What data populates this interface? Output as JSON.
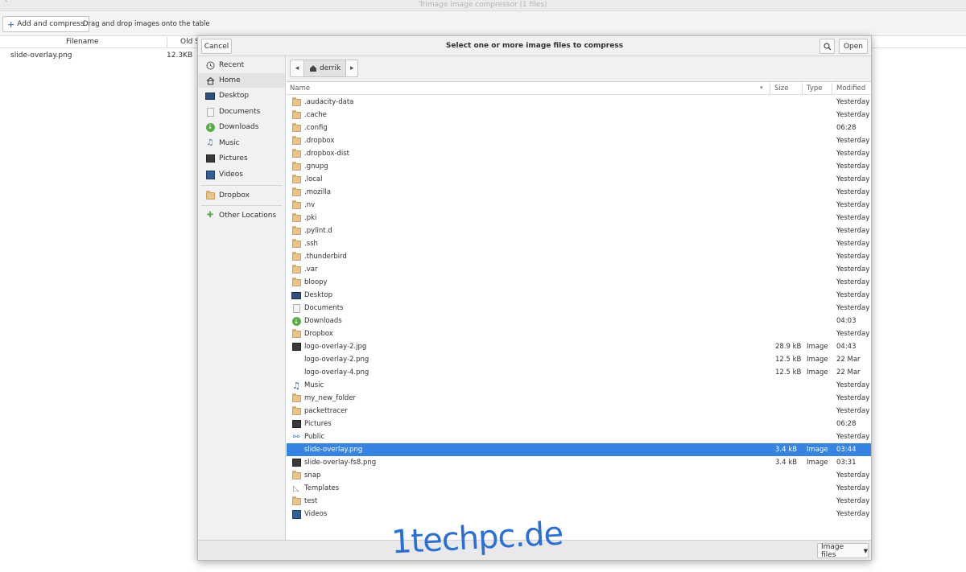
{
  "main_window": {
    "title": "Trimage image compressor (1 files)",
    "add_button_label": "Add and compress",
    "hint": "Drag and drop images onto the table",
    "columns": [
      "Filename",
      "Old S"
    ],
    "rows": [
      {
        "filename": "slide-overlay.png",
        "old_size": "12.3KB"
      }
    ]
  },
  "dialog": {
    "title": "Select one or more image files to compress",
    "cancel_label": "Cancel",
    "open_label": "Open",
    "sidebar": {
      "places": [
        {
          "label": "Recent",
          "icon": "recent-icon"
        },
        {
          "label": "Home",
          "icon": "home-icon",
          "selected": true
        },
        {
          "label": "Desktop",
          "icon": "desktop-icon"
        },
        {
          "label": "Documents",
          "icon": "documents-icon"
        },
        {
          "label": "Downloads",
          "icon": "downloads-icon"
        },
        {
          "label": "Music",
          "icon": "music-icon"
        },
        {
          "label": "Pictures",
          "icon": "pictures-icon"
        },
        {
          "label": "Videos",
          "icon": "videos-icon"
        }
      ],
      "bookmarks": [
        {
          "label": "Dropbox",
          "icon": "folder-icon"
        }
      ],
      "other": [
        {
          "label": "Other Locations",
          "icon": "other-locations-icon"
        }
      ]
    },
    "path": {
      "current": "derrik"
    },
    "columns": {
      "name": "Name",
      "size": "Size",
      "type": "Type",
      "modified": "Modified"
    },
    "files": [
      {
        "name": ".audacity-data",
        "icon": "folder",
        "size": "",
        "type": "",
        "modified": "Yesterday"
      },
      {
        "name": ".cache",
        "icon": "folder",
        "size": "",
        "type": "",
        "modified": "Yesterday"
      },
      {
        "name": ".config",
        "icon": "folder",
        "size": "",
        "type": "",
        "modified": "06:28"
      },
      {
        "name": ".dropbox",
        "icon": "folder",
        "size": "",
        "type": "",
        "modified": "Yesterday"
      },
      {
        "name": ".dropbox-dist",
        "icon": "folder",
        "size": "",
        "type": "",
        "modified": "Yesterday"
      },
      {
        "name": ".gnupg",
        "icon": "folder",
        "size": "",
        "type": "",
        "modified": "Yesterday"
      },
      {
        "name": ".local",
        "icon": "folder",
        "size": "",
        "type": "",
        "modified": "Yesterday"
      },
      {
        "name": ".mozilla",
        "icon": "folder",
        "size": "",
        "type": "",
        "modified": "Yesterday"
      },
      {
        "name": ".nv",
        "icon": "folder",
        "size": "",
        "type": "",
        "modified": "Yesterday"
      },
      {
        "name": ".pki",
        "icon": "folder",
        "size": "",
        "type": "",
        "modified": "Yesterday"
      },
      {
        "name": ".pylint.d",
        "icon": "folder",
        "size": "",
        "type": "",
        "modified": "Yesterday"
      },
      {
        "name": ".ssh",
        "icon": "folder",
        "size": "",
        "type": "",
        "modified": "Yesterday"
      },
      {
        "name": ".thunderbird",
        "icon": "folder",
        "size": "",
        "type": "",
        "modified": "Yesterday"
      },
      {
        "name": ".var",
        "icon": "folder",
        "size": "",
        "type": "",
        "modified": "Yesterday"
      },
      {
        "name": "bloopy",
        "icon": "folder",
        "size": "",
        "type": "",
        "modified": "Yesterday"
      },
      {
        "name": "Desktop",
        "icon": "desktop",
        "size": "",
        "type": "",
        "modified": "Yesterday"
      },
      {
        "name": "Documents",
        "icon": "document",
        "size": "",
        "type": "",
        "modified": "Yesterday"
      },
      {
        "name": "Downloads",
        "icon": "download",
        "size": "",
        "type": "",
        "modified": "04:03"
      },
      {
        "name": "Dropbox",
        "icon": "folder",
        "size": "",
        "type": "",
        "modified": "Yesterday"
      },
      {
        "name": "logo-overlay-2.jpg",
        "icon": "image",
        "size": "28.9 kB",
        "type": "Image",
        "modified": "04:43"
      },
      {
        "name": "logo-overlay-2.png",
        "icon": "none",
        "size": "12.5 kB",
        "type": "Image",
        "modified": "22 Mar"
      },
      {
        "name": "logo-overlay-4.png",
        "icon": "none",
        "size": "12.5 kB",
        "type": "Image",
        "modified": "22 Mar"
      },
      {
        "name": "Music",
        "icon": "music",
        "size": "",
        "type": "",
        "modified": "Yesterday"
      },
      {
        "name": "my_new_folder",
        "icon": "folder",
        "size": "",
        "type": "",
        "modified": "Yesterday"
      },
      {
        "name": "packettracer",
        "icon": "folder",
        "size": "",
        "type": "",
        "modified": "Yesterday"
      },
      {
        "name": "Pictures",
        "icon": "image",
        "size": "",
        "type": "",
        "modified": "06:28"
      },
      {
        "name": "Public",
        "icon": "share",
        "size": "",
        "type": "",
        "modified": "Yesterday"
      },
      {
        "name": "slide-overlay.png",
        "icon": "none",
        "size": "3.4 kB",
        "type": "Image",
        "modified": "03:44",
        "selected": true
      },
      {
        "name": "slide-overlay-fs8.png",
        "icon": "image",
        "size": "3.4 kB",
        "type": "Image",
        "modified": "03:31"
      },
      {
        "name": "snap",
        "icon": "folder",
        "size": "",
        "type": "",
        "modified": "Yesterday"
      },
      {
        "name": "Templates",
        "icon": "template",
        "size": "",
        "type": "",
        "modified": "Yesterday"
      },
      {
        "name": "test",
        "icon": "folder",
        "size": "",
        "type": "",
        "modified": "Yesterday"
      },
      {
        "name": "Videos",
        "icon": "video",
        "size": "",
        "type": "",
        "modified": "Yesterday"
      }
    ],
    "filter": {
      "selected": "Image files"
    }
  },
  "watermark": "1techpc.de",
  "colors": {
    "selection": "#3584e4",
    "folder": "#e8c48a",
    "watermark": "#2a6fd6"
  }
}
